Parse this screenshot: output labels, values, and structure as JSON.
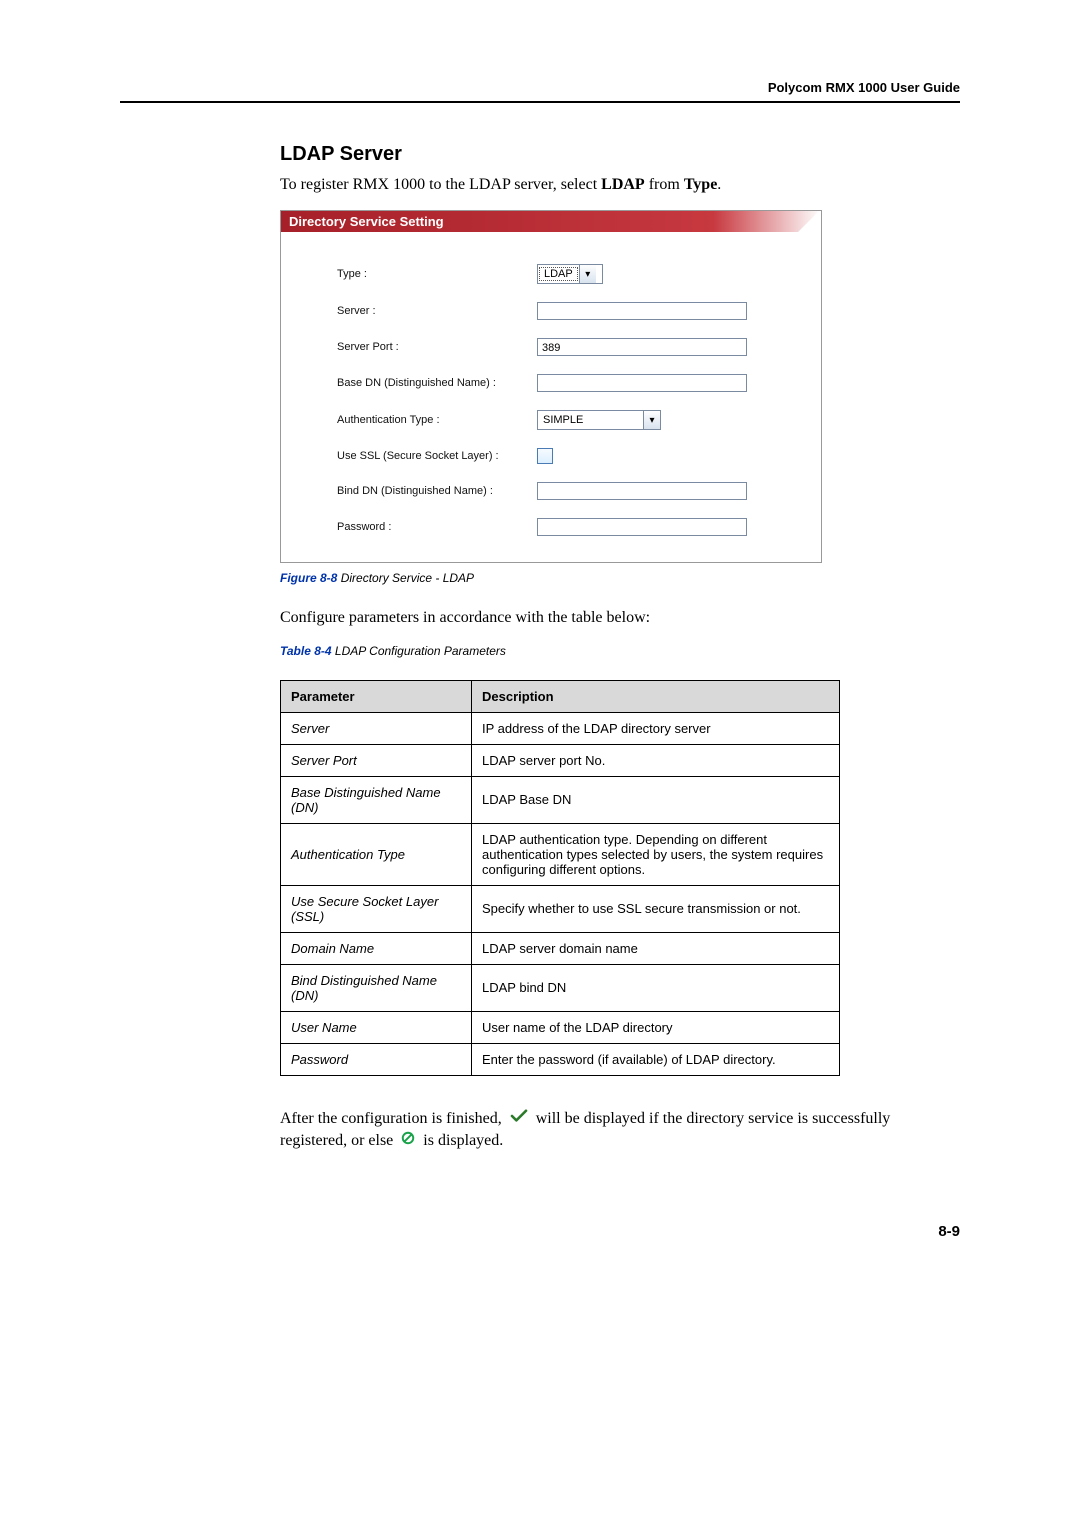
{
  "header": {
    "running_title": "Polycom RMX 1000 User Guide"
  },
  "section": {
    "title": "LDAP Server",
    "intro_pre": "To register RMX 1000 to the LDAP server, select ",
    "intro_bold1": "LDAP",
    "intro_mid": " from ",
    "intro_bold2": "Type",
    "intro_post": "."
  },
  "panel": {
    "title": "Directory Service Setting",
    "rows": {
      "type": {
        "label": "Type :",
        "value": "LDAP"
      },
      "server": {
        "label": "Server :",
        "value": ""
      },
      "server_port": {
        "label": "Server Port :",
        "value": "389"
      },
      "base_dn": {
        "label": "Base DN (Distinguished Name) :",
        "value": ""
      },
      "auth_type": {
        "label": "Authentication Type :",
        "value": "SIMPLE"
      },
      "use_ssl": {
        "label": "Use SSL (Secure Socket Layer) :"
      },
      "bind_dn": {
        "label": "Bind DN (Distinguished Name) :",
        "value": ""
      },
      "password": {
        "label": "Password :",
        "value": ""
      }
    }
  },
  "figure_caption": {
    "label": "Figure 8-8",
    "text": " Directory Service - LDAP"
  },
  "configure_line": "Configure parameters in accordance with the table below:",
  "table_caption": {
    "label": "Table 8-4",
    "text": " LDAP Configuration Parameters"
  },
  "table": {
    "headers": {
      "param": "Parameter",
      "desc": "Description"
    },
    "rows": [
      {
        "param": "Server",
        "desc": "IP address of the LDAP directory server"
      },
      {
        "param": "Server Port",
        "desc": "LDAP server port No."
      },
      {
        "param": "Base Distinguished Name (DN)",
        "desc": "LDAP Base DN"
      },
      {
        "param": "Authentication Type",
        "desc": "LDAP authentication type. Depending on different authentication types selected by users, the system requires configuring different options."
      },
      {
        "param": "Use Secure Socket Layer (SSL)",
        "desc": "Specify whether to use SSL secure transmission or not."
      },
      {
        "param": "Domain Name",
        "desc": "LDAP server domain name"
      },
      {
        "param": "Bind Distinguished Name (DN)",
        "desc": "LDAP bind DN"
      },
      {
        "param": "User Name",
        "desc": "User name of the LDAP directory"
      },
      {
        "param": "Password",
        "desc": "Enter the password (if available) of LDAP directory."
      }
    ]
  },
  "after": {
    "part1": "After the configuration is finished, ",
    "part2": " will be displayed if the directory service is successfully registered, or else ",
    "part3": " is displayed."
  },
  "footer": {
    "page_number": "8-9"
  }
}
